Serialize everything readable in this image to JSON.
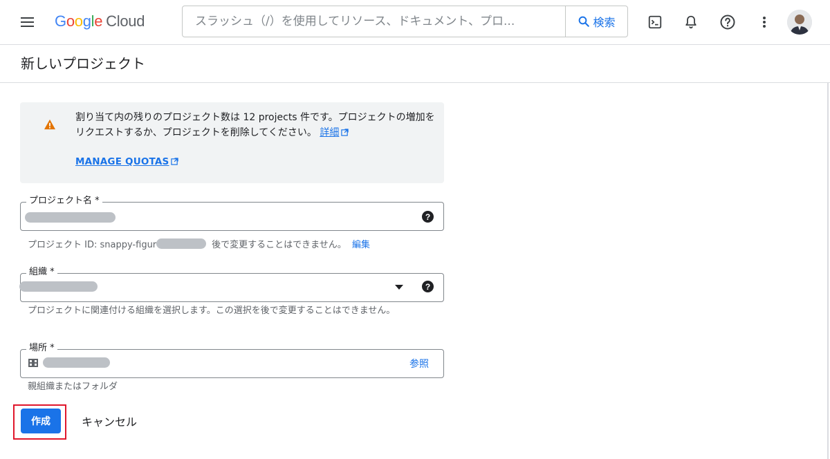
{
  "topbar": {
    "logo_google": [
      "G",
      "o",
      "o",
      "g",
      "l",
      "e"
    ],
    "logo_cloud": "Cloud",
    "search_placeholder": "スラッシュ（/）を使用してリソース、ドキュメント、プロ...",
    "search_button": "検索"
  },
  "page": {
    "title": "新しいプロジェクト"
  },
  "quota": {
    "message": "割り当て内の残りのプロジェクト数は 12 projects 件です。プロジェクトの増加をリクエストするか、プロジェクトを削除してください。",
    "details_link": "詳細",
    "manage_link": "MANAGE QUOTAS"
  },
  "project_name": {
    "label": "プロジェクト名 *",
    "id_prefix": "プロジェクト ID: snappy-figur",
    "id_note": "後で変更することはできません。",
    "edit_link": "編集"
  },
  "organization": {
    "label": "組織 *",
    "helper": "プロジェクトに関連付ける組織を選択します。この選択を後で変更することはできません。"
  },
  "location": {
    "label": "場所 *",
    "browse": "参照",
    "helper": "親組織またはフォルダ"
  },
  "actions": {
    "create": "作成",
    "cancel": "キャンセル"
  },
  "colors": {
    "primary": "#1a73e8",
    "warning": "#e37400",
    "highlight": "#e0162b"
  }
}
